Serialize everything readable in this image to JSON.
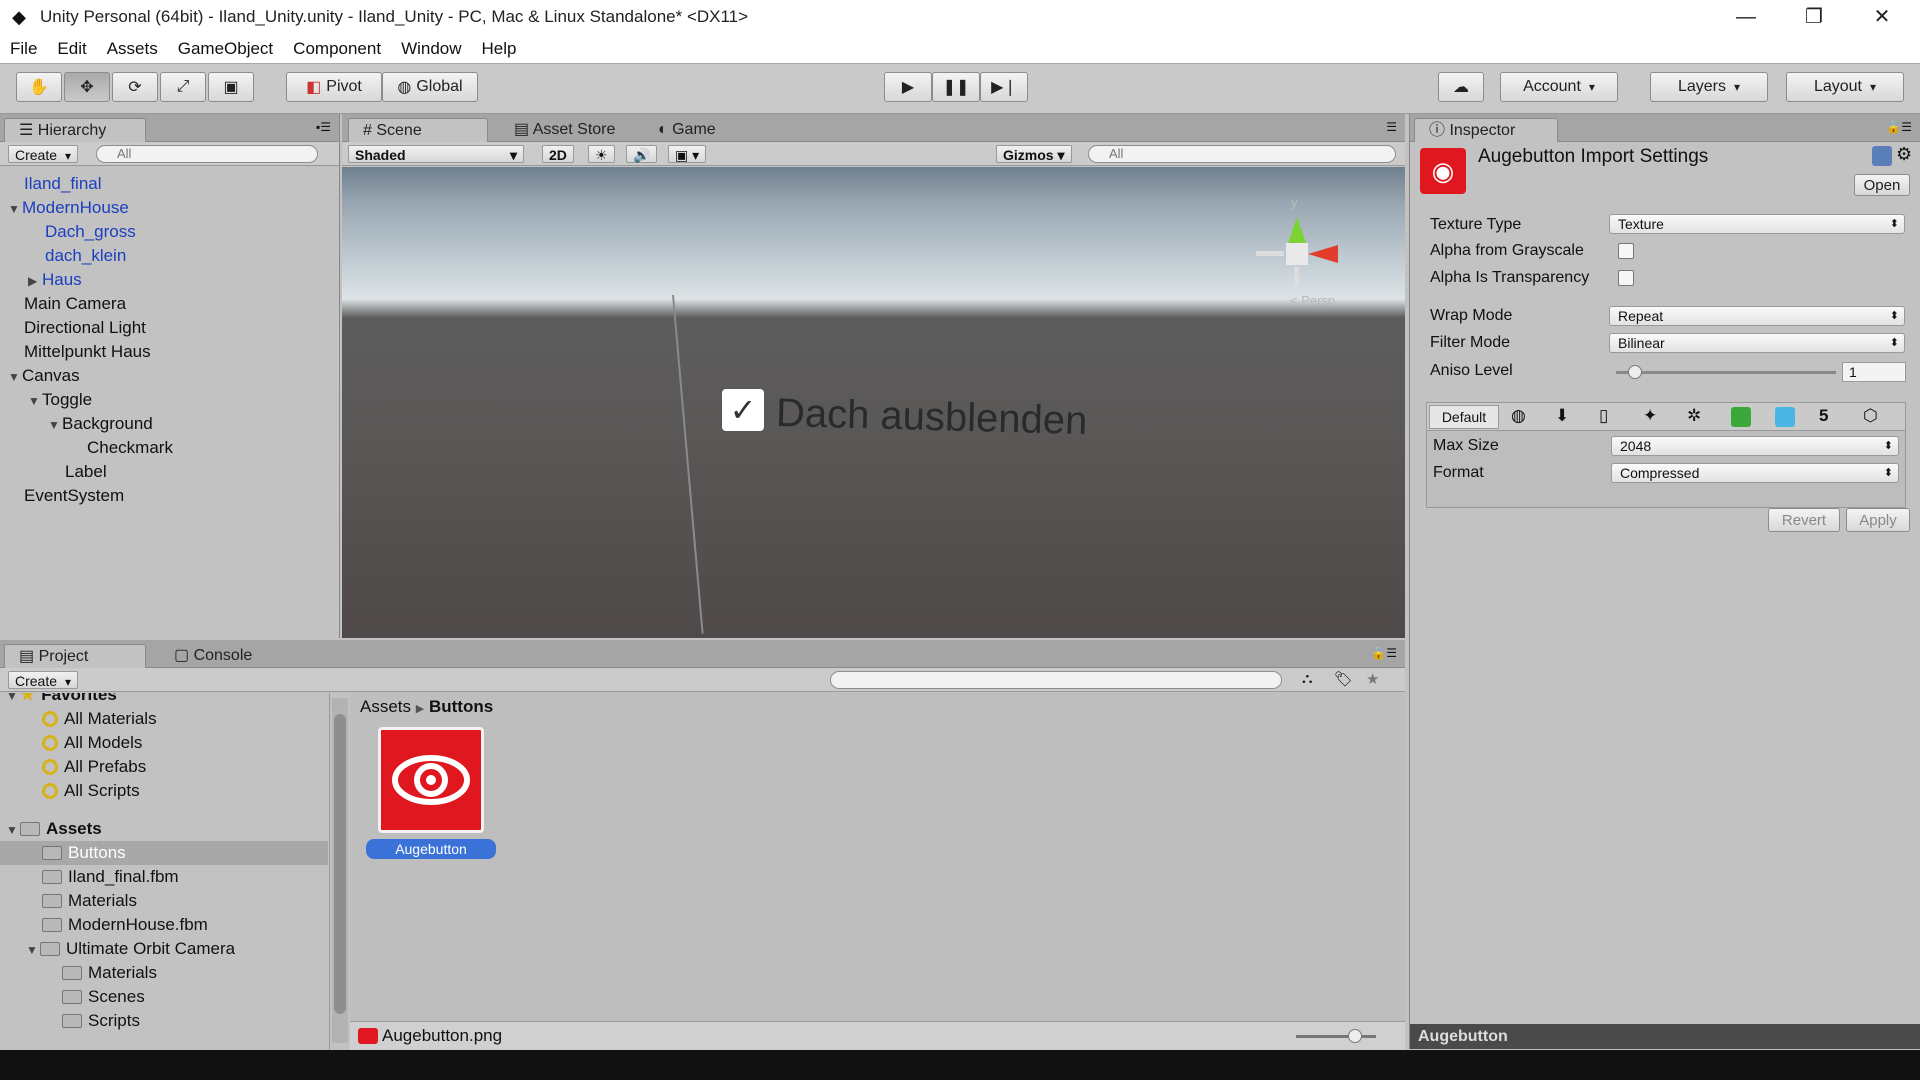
{
  "window": {
    "title": "Unity Personal (64bit) - Iland_Unity.unity - Iland_Unity - PC, Mac & Linux Standalone* <DX11>"
  },
  "menu": [
    "File",
    "Edit",
    "Assets",
    "GameObject",
    "Component",
    "Window",
    "Help"
  ],
  "toolbar": {
    "pivot": "Pivot",
    "global": "Global",
    "account": "Account",
    "layers": "Layers",
    "layout": "Layout"
  },
  "hierarchy": {
    "tab": "Hierarchy",
    "create": "Create",
    "search_placeholder": "All",
    "items": [
      "Iland_final",
      "ModernHouse",
      "Dach_gross",
      "dach_klein",
      "Haus",
      "Main Camera",
      "Directional Light",
      "Mittelpunkt Haus",
      "Canvas",
      "Toggle",
      "Background",
      "Checkmark",
      "Label",
      "EventSystem"
    ]
  },
  "scene": {
    "tabs": [
      "Scene",
      "Asset Store",
      "Game"
    ],
    "shading": "Shaded",
    "mode_2d": "2D",
    "gizmos": "Gizmos",
    "search_placeholder": "All",
    "toggle_label": "Dach ausblenden",
    "persp": "< Persp",
    "axis_y": "y"
  },
  "inspector": {
    "tab": "Inspector",
    "title": "Augebutton Import Settings",
    "open": "Open",
    "props": [
      {
        "label": "Texture Type",
        "value": "Texture"
      },
      {
        "label": "Alpha from Grayscale",
        "checked": false
      },
      {
        "label": "Alpha Is Transparency",
        "checked": false
      },
      {
        "label": "Wrap Mode",
        "value": "Repeat"
      },
      {
        "label": "Filter Mode",
        "value": "Bilinear"
      },
      {
        "label": "Aniso Level",
        "value": "1"
      }
    ],
    "platform_default": "Default",
    "max_size": {
      "label": "Max Size",
      "value": "2048"
    },
    "format": {
      "label": "Format",
      "value": "Compressed"
    },
    "revert": "Revert",
    "apply": "Apply",
    "preview_label": "Augebutton",
    "aniso_fraction": 0.06
  },
  "project": {
    "tabs": [
      "Project",
      "Console"
    ],
    "create": "Create",
    "favorites": {
      "label": "Favorites",
      "items": [
        "All Materials",
        "All Models",
        "All Prefabs",
        "All Scripts"
      ]
    },
    "assets": {
      "label": "Assets",
      "items": [
        "Buttons",
        "Iland_final.fbm",
        "Materials",
        "ModernHouse.fbm",
        "Ultimate Orbit Camera",
        "Materials",
        "Scenes",
        "Scripts"
      ]
    },
    "breadcrumb": [
      "Assets",
      "Buttons"
    ],
    "asset_name": "Augebutton",
    "status_file": "Augebutton.png"
  },
  "colors": {
    "accent_red": "#e0171f",
    "selection_blue": "#3a72d8"
  }
}
